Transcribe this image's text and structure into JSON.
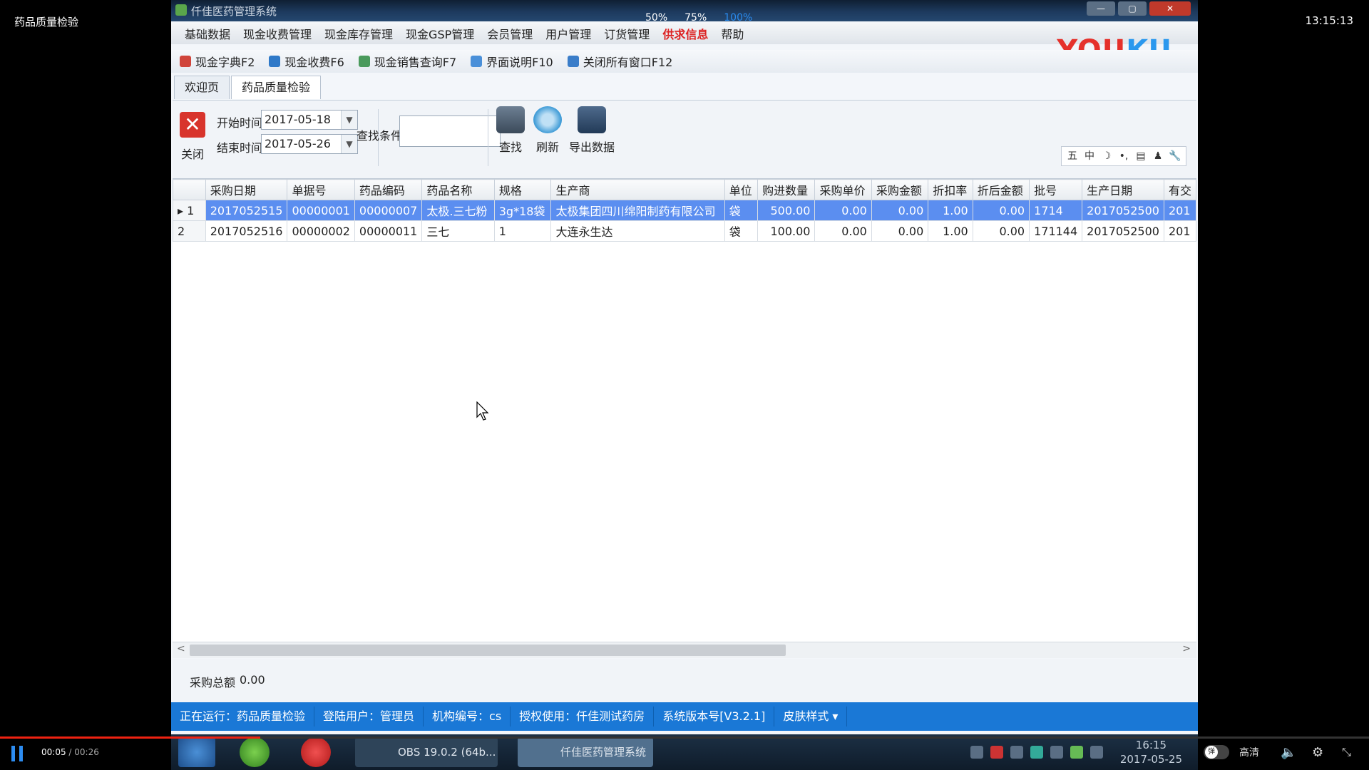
{
  "player": {
    "title": "药品质量检验",
    "clock": "13:15:13",
    "zoom_levels": [
      "50%",
      "75%",
      "100%"
    ],
    "current_time": "00:05",
    "duration": "/ 00:26",
    "progress_fraction": 0.19,
    "quality_label": "高清",
    "toggle_label": "弹"
  },
  "window": {
    "title": "仟佳医药管理系统",
    "buttons": [
      "—",
      "▢",
      "✕"
    ]
  },
  "menu": [
    "基础数据",
    "现金收费管理",
    "现金库存管理",
    "现金GSP管理",
    "会员管理",
    "用户管理",
    "订货管理",
    "供求信息",
    "帮助"
  ],
  "brand": {
    "a": "YOU",
    "b": "KU"
  },
  "toolbar": [
    {
      "label": "现金字典F2",
      "color": "#d0453b"
    },
    {
      "label": "现金收费F6",
      "color": "#2f79c8"
    },
    {
      "label": "现金销售查询F7",
      "color": "#4a9a5c"
    },
    {
      "label": "界面说明F10",
      "color": "#4a90d9"
    },
    {
      "label": "关闭所有窗口F12",
      "color": "#3a7dc9"
    }
  ],
  "tabs": [
    "欢迎页",
    "药品质量检验"
  ],
  "filters": {
    "close_label": "关闭",
    "start_label": "开始时间",
    "start_value": "2017-05-18",
    "end_label": "结束时间",
    "end_value": "2017-05-26",
    "search_label": "查找条件",
    "search_value": ""
  },
  "actions": [
    {
      "label": "查找",
      "icon": "binoculars-icon"
    },
    {
      "label": "刷新",
      "icon": "refresh-icon"
    },
    {
      "label": "导出数据",
      "icon": "save-export-icon"
    }
  ],
  "mini_icons": [
    "五",
    "中",
    "☽",
    "•,",
    "▤",
    "♟",
    "🔧"
  ],
  "table": {
    "columns": [
      "",
      "采购日期",
      "单据号",
      "药品编码",
      "药品名称",
      "规格",
      "生产商",
      "单位",
      "购进数量",
      "采购单价",
      "采购金额",
      "折扣率",
      "折后金额",
      "批号",
      "生产日期",
      "有交"
    ],
    "rows": [
      [
        "▸ 1",
        "2017052515",
        "00000001",
        "00000007",
        "太极.三七粉",
        "3g*18袋",
        "太极集团四川绵阳制药有限公司",
        "袋",
        "500.00",
        "0.00",
        "0.00",
        "1.00",
        "0.00",
        "1714",
        "2017052500",
        "201"
      ],
      [
        "2",
        "2017052516",
        "00000002",
        "00000011",
        "三七",
        "1",
        "大连永生达",
        "袋",
        "100.00",
        "0.00",
        "0.00",
        "1.00",
        "0.00",
        "171144",
        "2017052500",
        "201"
      ]
    ]
  },
  "total": {
    "label": "采购总额",
    "value": "0.00"
  },
  "status": [
    "正在运行：药品质量检验",
    "登陆用户：管理员",
    "机构编号：cs",
    "授权使用：仟佳测试药房",
    "系统版本号[V3.2.1]",
    "皮肤样式 ▾"
  ],
  "taskbar": {
    "obs_label": "OBS 19.0.2 (64b...",
    "app_label": "仟佳医药管理系统",
    "time": "16:15",
    "date": "2017-05-25"
  }
}
